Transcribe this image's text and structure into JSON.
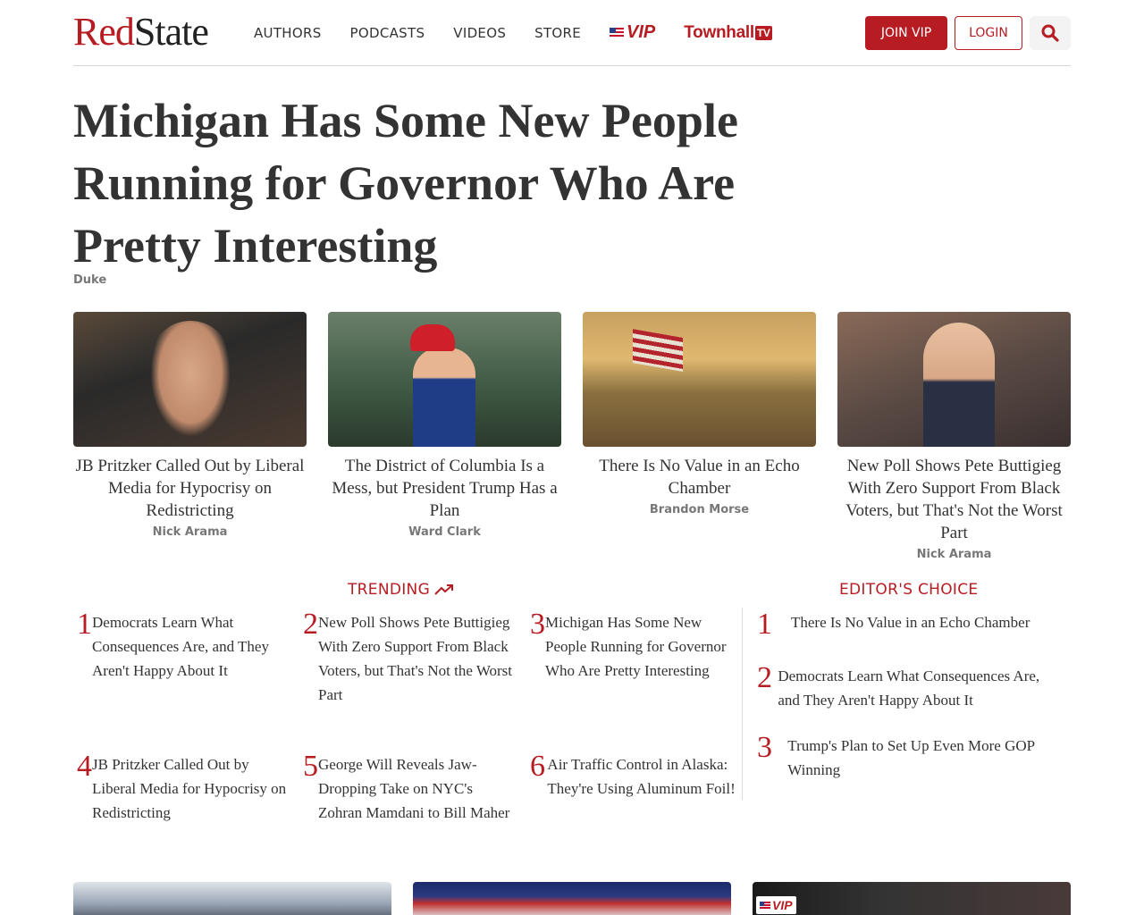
{
  "header": {
    "logo_red": "Red",
    "logo_black": "State",
    "nav": [
      "AUTHORS",
      "PODCASTS",
      "VIDEOS",
      "STORE"
    ],
    "vip_label": "VIP",
    "townhall_label": "Townhall",
    "townhall_tv": "TV",
    "join_label": "JOIN VIP",
    "login_label": "LOGIN"
  },
  "hero": {
    "headline": "Michigan Has Some New People Running for Governor Who Are Pretty Interesting",
    "author": "Duke"
  },
  "cards": [
    {
      "title": "JB Pritzker Called Out by Liberal Media for Hypocrisy on Redistricting",
      "author": "Nick Arama"
    },
    {
      "title": "The District of Columbia Is a Mess, but President Trump Has a Plan",
      "author": "Ward Clark"
    },
    {
      "title": "There Is No Value in an Echo Chamber",
      "author": "Brandon Morse"
    },
    {
      "title": "New Poll Shows Pete Buttigieg With Zero Support From Black Voters, but That's Not the Worst Part",
      "author": "Nick Arama"
    }
  ],
  "trending": {
    "title": "TRENDING",
    "items": [
      {
        "rank": "1",
        "text": "Democrats Learn What Consequences Are, and They Aren't Happy About It"
      },
      {
        "rank": "2",
        "text": "New Poll Shows Pete Buttigieg With Zero Support From Black Voters, but That's Not the Worst Part"
      },
      {
        "rank": "3",
        "text": "Michigan Has Some New People Running for Governor Who Are Pretty Interesting"
      },
      {
        "rank": "4",
        "text": "JB Pritzker Called Out by Liberal Media for Hypocrisy on Redistricting"
      },
      {
        "rank": "5",
        "text": "George Will Reveals Jaw-Dropping Take on NYC's Zohran Mamdani to Bill Maher"
      },
      {
        "rank": "6",
        "text": "Air Traffic Control in Alaska: They're Using Aluminum Foil!"
      }
    ]
  },
  "editors": {
    "title": "EDITOR'S CHOICE",
    "items": [
      {
        "rank": "1",
        "text": "There Is No Value in an Echo Chamber"
      },
      {
        "rank": "2",
        "text": "Democrats Learn What Consequences Are, and They Aren't Happy About It"
      },
      {
        "rank": "3",
        "text": "Trump's Plan to Set Up Even More GOP Winning"
      }
    ]
  },
  "tiles": {
    "vip_label": "VIP"
  },
  "colors": {
    "brand_red": "#b71c22",
    "text": "#333333",
    "muted": "#777777"
  },
  "icons": [
    "search-icon",
    "trending-arrow-icon",
    "flag-icon"
  ]
}
